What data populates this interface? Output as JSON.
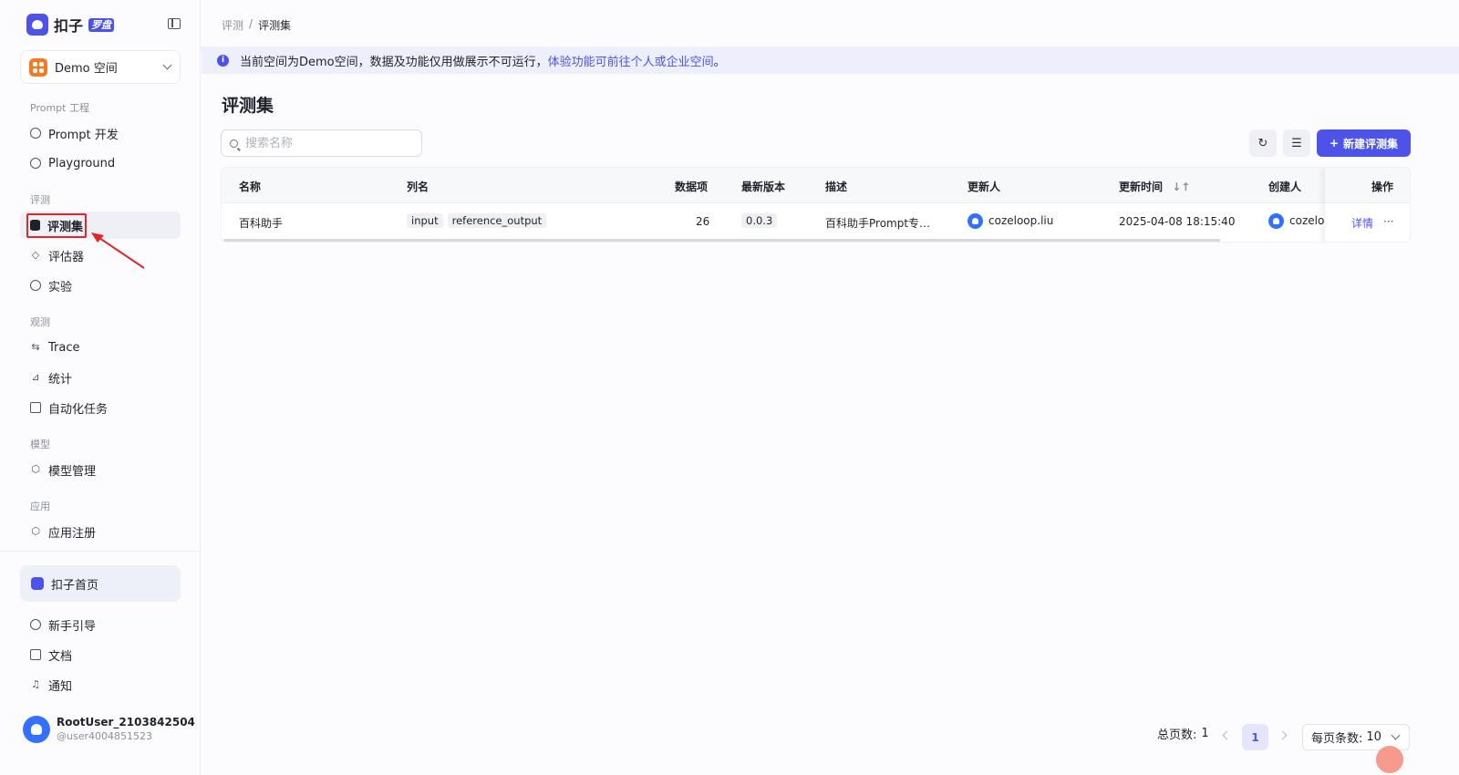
{
  "brand": {
    "name": "扣子",
    "badge": "罗盘"
  },
  "space": {
    "name": "Demo 空间"
  },
  "nav": {
    "groups": [
      {
        "label": "Prompt 工程"
      },
      {
        "label": "评测"
      },
      {
        "label": "观测"
      },
      {
        "label": "模型"
      },
      {
        "label": "应用"
      }
    ],
    "items": [
      {
        "label": "Prompt 开发"
      },
      {
        "label": "Playground"
      },
      {
        "label": "评测集"
      },
      {
        "label": "评估器"
      },
      {
        "label": "实验"
      },
      {
        "label": "Trace"
      },
      {
        "label": "统计"
      },
      {
        "label": "自动化任务"
      },
      {
        "label": "模型管理"
      },
      {
        "label": "应用注册"
      }
    ],
    "home": "扣子首页",
    "bottom": [
      {
        "label": "新手引导"
      },
      {
        "label": "文档"
      },
      {
        "label": "通知"
      }
    ]
  },
  "user": {
    "name": "RootUser_2103842504",
    "handle": "@user4004851523"
  },
  "breadcrumb": {
    "parent": "评测",
    "sep": "/",
    "current": "评测集"
  },
  "banner": {
    "text": "当前空间为Demo空间，数据及功能仅用做展示不可运行，",
    "link": "体验功能可前往个人或企业空间",
    "end": "。"
  },
  "page": {
    "title": "评测集"
  },
  "search": {
    "placeholder": "搜索名称"
  },
  "toolbar": {
    "new_label": "新建评测集"
  },
  "table": {
    "columns": [
      "名称",
      "列名",
      "数据项",
      "最新版本",
      "描述",
      "更新人",
      "更新时间",
      "创建人",
      "操作"
    ],
    "rows": [
      {
        "name": "百科助手",
        "fields": [
          "input",
          "reference_output"
        ],
        "items": "26",
        "version": "0.0.3",
        "description": "百科助手Prompt专…",
        "updated_by": "cozeloop.liu",
        "updated_at": "2025-04-08 18:15:40",
        "created_by": "cozeloo",
        "action_detail": "详情",
        "action_more": "···"
      }
    ]
  },
  "pagination": {
    "total_label": "总页数:",
    "total": "1",
    "current": "1",
    "size_label": "每页条数:",
    "size": "10"
  },
  "colors": {
    "accent": "#4d53e8",
    "highlight": "#e0262b"
  }
}
